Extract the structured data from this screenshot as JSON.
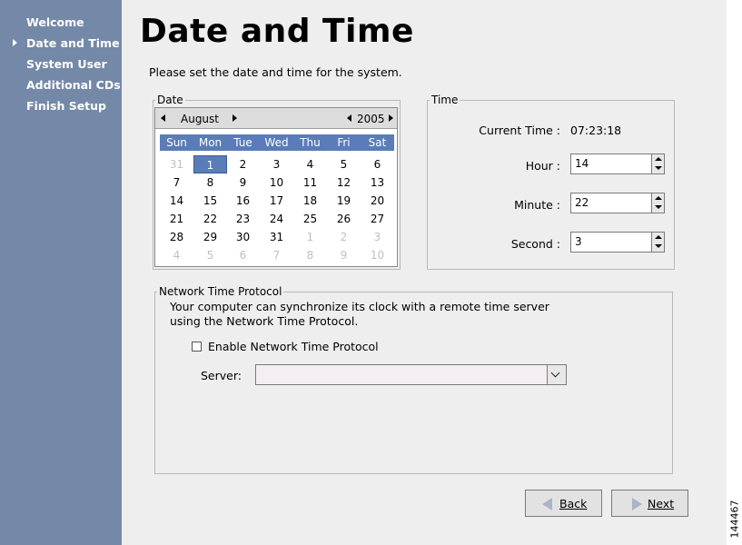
{
  "sidebar": {
    "items": [
      {
        "label": "Welcome",
        "current": false
      },
      {
        "label": "Date and Time",
        "current": true
      },
      {
        "label": "System User",
        "current": false
      },
      {
        "label": "Additional CDs",
        "current": false
      },
      {
        "label": "Finish Setup",
        "current": false
      }
    ]
  },
  "page": {
    "title": "Date and Time",
    "subtitle": "Please set the date and time for the system."
  },
  "date_frame": {
    "label": "Date",
    "month": "August",
    "year": "2005",
    "weekdays": [
      "Sun",
      "Mon",
      "Tue",
      "Wed",
      "Thu",
      "Fri",
      "Sat"
    ],
    "weeks": [
      [
        "31",
        "1",
        "2",
        "3",
        "4",
        "5",
        "6"
      ],
      [
        "7",
        "8",
        "9",
        "10",
        "11",
        "12",
        "13"
      ],
      [
        "14",
        "15",
        "16",
        "17",
        "18",
        "19",
        "20"
      ],
      [
        "21",
        "22",
        "23",
        "24",
        "25",
        "26",
        "27"
      ],
      [
        "28",
        "29",
        "30",
        "31",
        "1",
        "2",
        "3"
      ],
      [
        "4",
        "5",
        "6",
        "7",
        "8",
        "9",
        "10"
      ]
    ],
    "selected_day": "1"
  },
  "time_frame": {
    "label": "Time",
    "current_time_label": "Current Time :",
    "current_time_value": "07:23:18",
    "hour_label": "Hour :",
    "hour_value": "14",
    "minute_label": "Minute :",
    "minute_value": "22",
    "second_label": "Second :",
    "second_value": "3"
  },
  "ntp": {
    "label": "Network Time Protocol",
    "description_line1": "Your computer can synchronize its clock with a remote time server",
    "description_line2": "using the Network Time Protocol.",
    "enable_label": "Enable Network Time Protocol",
    "enable_checked": false,
    "server_label": "Server:",
    "server_value": ""
  },
  "buttons": {
    "back": "Back",
    "next": "Next"
  },
  "figure_code": "144467"
}
